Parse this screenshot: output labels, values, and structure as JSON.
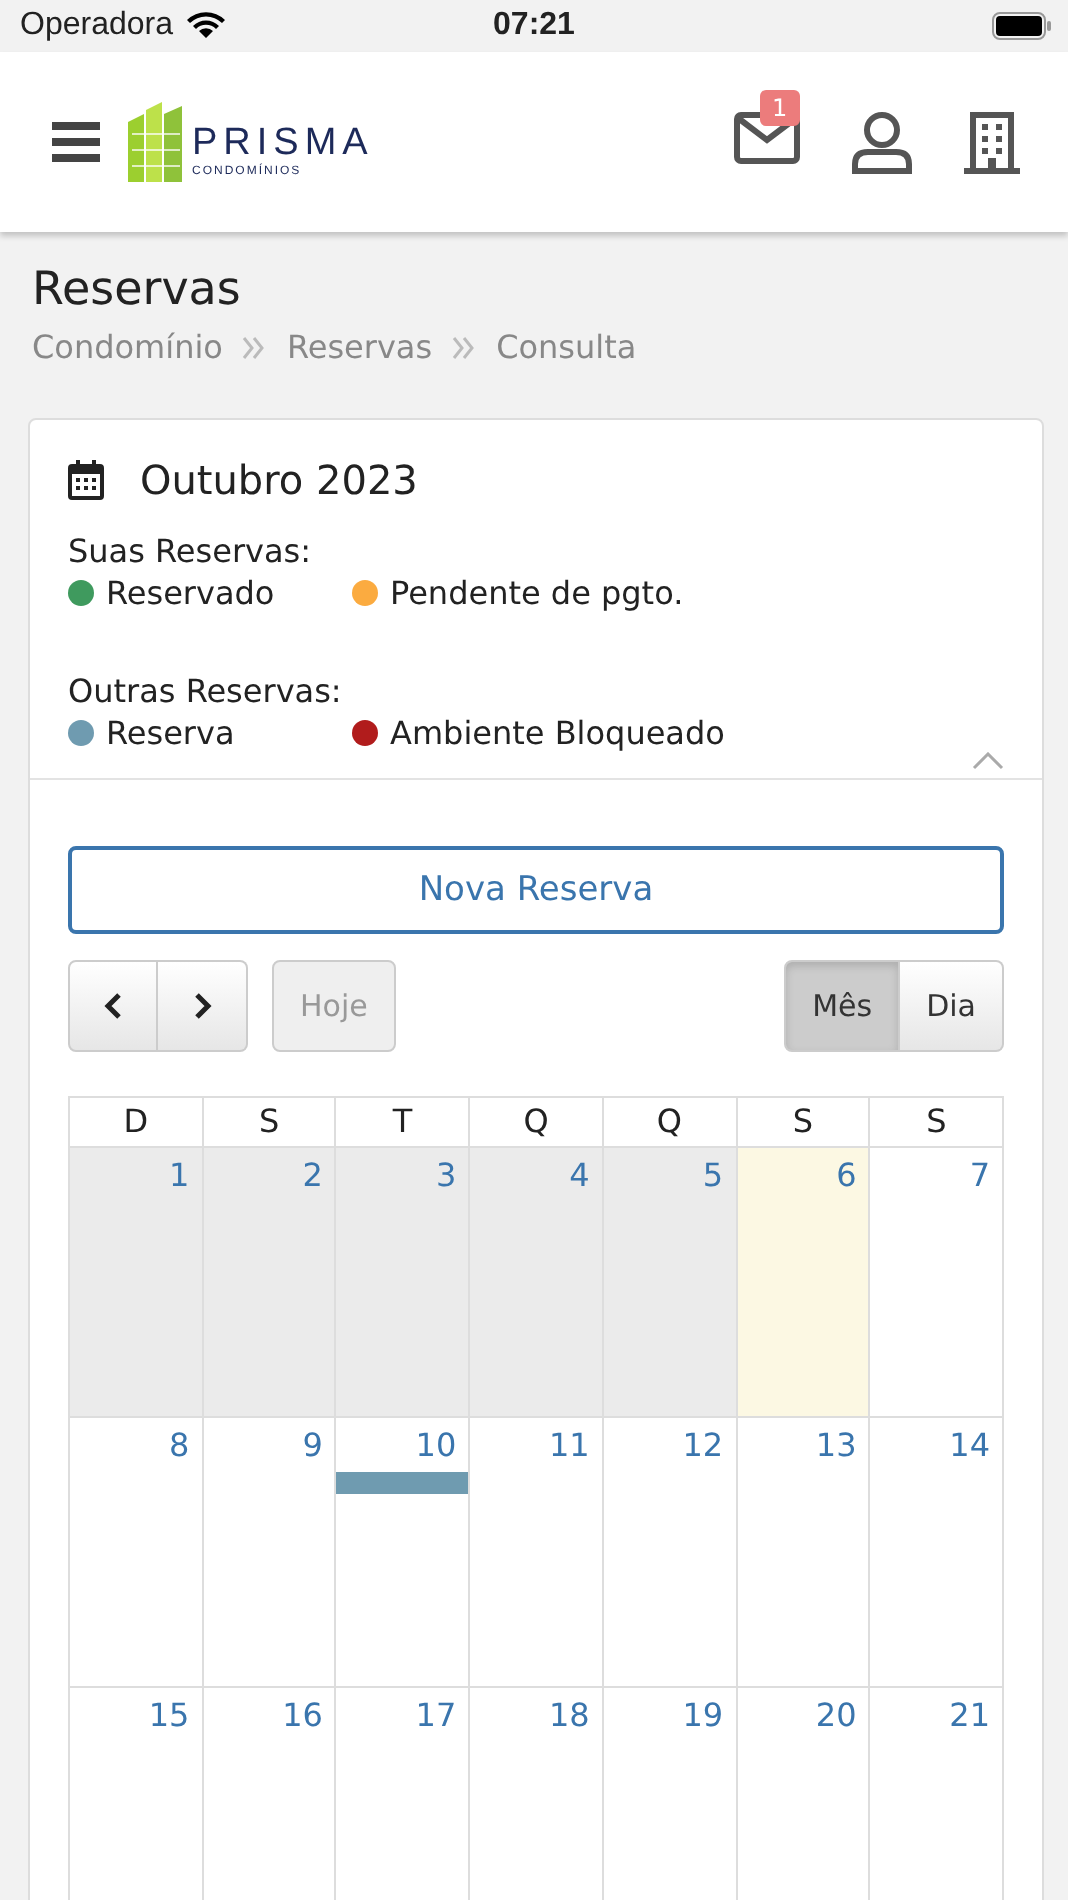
{
  "status_bar": {
    "carrier": "Operadora",
    "time": "07:21"
  },
  "header": {
    "logo_name": "PRISMA",
    "logo_subtitle": "CONDOMÍNIOS",
    "messages_badge": "1"
  },
  "page": {
    "title": "Reservas",
    "breadcrumb": [
      "Condomínio",
      "Reservas",
      "Consulta"
    ]
  },
  "card": {
    "month": "Outubro 2023",
    "expanded": true,
    "legend": [
      {
        "title": "Suas Reservas:",
        "items": [
          {
            "label": "Reservado",
            "color": "#3f9a5e"
          },
          {
            "label": "Pendente de pgto.",
            "color": "#fbab40"
          }
        ]
      },
      {
        "title": "Outras Reservas:",
        "items": [
          {
            "label": "Reserva",
            "color": "#6f9bb0"
          },
          {
            "label": "Ambiente Bloqueado",
            "color": "#b11c1c"
          }
        ]
      }
    ],
    "new_button": "Nova Reserva",
    "today_button": {
      "label": "Hoje",
      "disabled": true
    },
    "views": [
      {
        "label": "Mês",
        "selected": true
      },
      {
        "label": "Dia",
        "selected": false
      }
    ],
    "calendar": {
      "weekdays": [
        "D",
        "S",
        "T",
        "Q",
        "Q",
        "S",
        "S"
      ],
      "weeks": [
        [
          {
            "day": "1",
            "past": true,
            "today": false
          },
          {
            "day": "2",
            "past": true,
            "today": false
          },
          {
            "day": "3",
            "past": true,
            "today": false
          },
          {
            "day": "4",
            "past": true,
            "today": false
          },
          {
            "day": "5",
            "past": true,
            "today": false
          },
          {
            "day": "6",
            "past": false,
            "today": true
          },
          {
            "day": "7",
            "past": false,
            "today": false
          }
        ],
        [
          {
            "day": "8",
            "past": false,
            "today": false
          },
          {
            "day": "9",
            "past": false,
            "today": false
          },
          {
            "day": "10",
            "past": false,
            "today": false,
            "events": [
              {
                "color": "#6f9bb0"
              }
            ]
          },
          {
            "day": "11",
            "past": false,
            "today": false
          },
          {
            "day": "12",
            "past": false,
            "today": false
          },
          {
            "day": "13",
            "past": false,
            "today": false
          },
          {
            "day": "14",
            "past": false,
            "today": false
          }
        ],
        [
          {
            "day": "15",
            "past": false,
            "today": false
          },
          {
            "day": "16",
            "past": false,
            "today": false
          },
          {
            "day": "17",
            "past": false,
            "today": false
          },
          {
            "day": "18",
            "past": false,
            "today": false
          },
          {
            "day": "19",
            "past": false,
            "today": false
          },
          {
            "day": "20",
            "past": false,
            "today": false
          },
          {
            "day": "21",
            "past": false,
            "today": false
          }
        ]
      ]
    }
  }
}
